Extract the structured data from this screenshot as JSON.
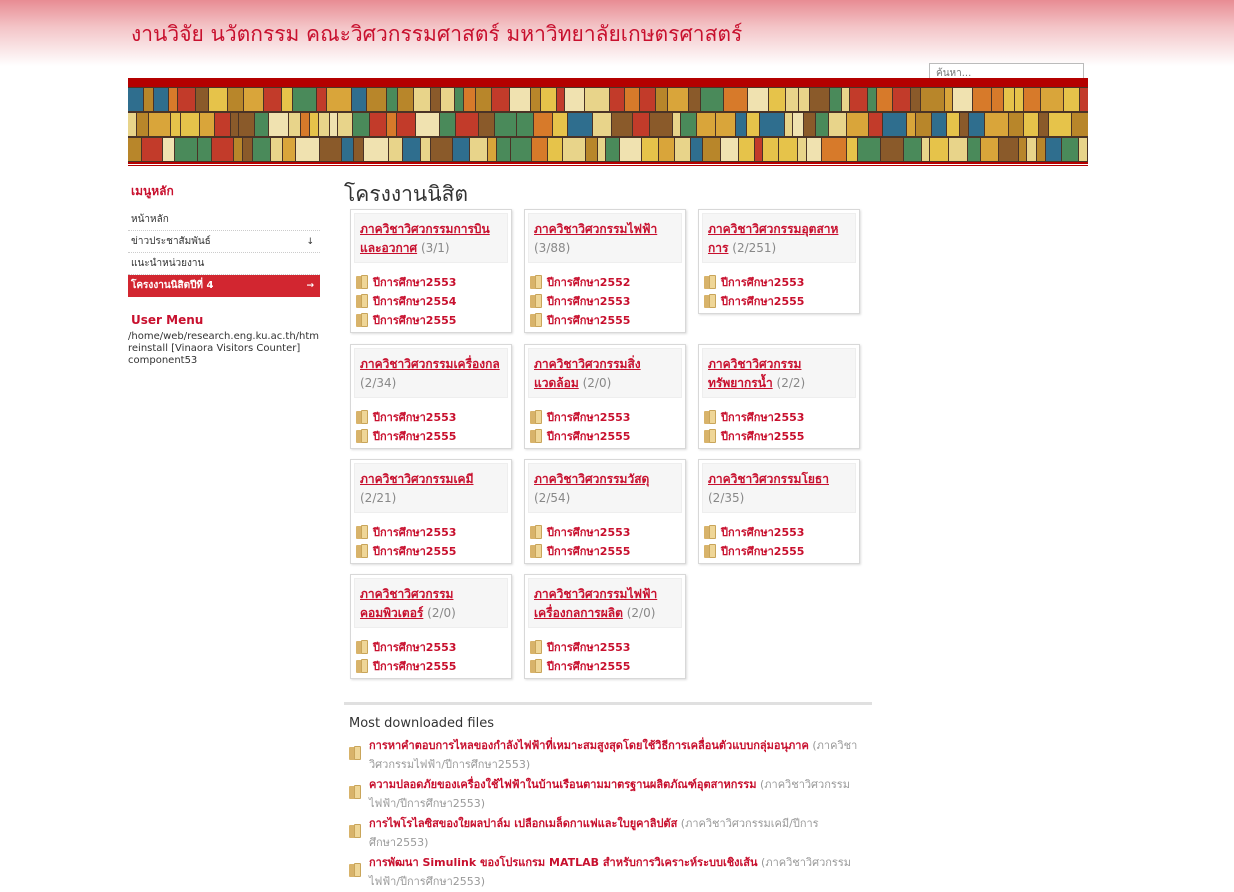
{
  "header": {
    "site_title": "งานวิจัย นวัตกรรม คณะวิศวกรรมศาสตร์ มหาวิทยาลัยเกษตรศาสตร์",
    "search_placeholder": "ค้นหา..."
  },
  "colors": {
    "brand": "#c8102e",
    "bar": "#b40000",
    "active": "#d22630"
  },
  "sidebar": {
    "menu_title": "เมนูหลัก",
    "items": [
      {
        "label": "หน้าหลัก",
        "arrow": ""
      },
      {
        "label": "ข่าวประชาสัมพันธ์",
        "arrow": "↓"
      },
      {
        "label": "แนะนำหน่วยงาน",
        "arrow": ""
      },
      {
        "label": "โครงงานนิสิตปีที่ 4",
        "arrow": "→"
      }
    ],
    "user_menu_title": "User Menu",
    "user_menu_lines": [
      "/home/web/research.eng.ku.ac.th/htm",
      "reinstall [Vinaora Visitors Counter]",
      "component53"
    ]
  },
  "main": {
    "page_title": "โครงงานนิสิต",
    "departments": [
      {
        "name": "ภาควิชาวิศวกรรมการบินและอวกาศ",
        "count": "(3/1)",
        "years": [
          "ปีการศึกษา2553",
          "ปีการศึกษา2554",
          "ปีการศึกษา2555"
        ]
      },
      {
        "name": "ภาควิชาวิศวกรรมไฟฟ้า",
        "count": "(3/88)",
        "years": [
          "ปีการศึกษา2552",
          "ปีการศึกษา2553",
          "ปีการศึกษา2555"
        ]
      },
      {
        "name": "ภาควิชาวิศวกรรมอุตสาหการ",
        "count": "(2/251)",
        "years": [
          "ปีการศึกษา2553",
          "ปีการศึกษา2555"
        ]
      },
      {
        "name": "ภาควิชาวิศวกรรมเครื่องกล",
        "count": "(2/34)",
        "years": [
          "ปีการศึกษา2553",
          "ปีการศึกษา2555"
        ]
      },
      {
        "name": "ภาควิชาวิศวกรรมสิ่งแวดล้อม",
        "count": "(2/0)",
        "years": [
          "ปีการศึกษา2553",
          "ปีการศึกษา2555"
        ]
      },
      {
        "name": "ภาควิชาวิศวกรรมทรัพยากรน้ำ",
        "count": "(2/2)",
        "years": [
          "ปีการศึกษา2553",
          "ปีการศึกษา2555"
        ]
      },
      {
        "name": "ภาควิชาวิศวกรรมเคมี",
        "count": "(2/21)",
        "years": [
          "ปีการศึกษา2553",
          "ปีการศึกษา2555"
        ]
      },
      {
        "name": "ภาควิชาวิศวกรรมวัสดุ",
        "count": "(2/54)",
        "years": [
          "ปีการศึกษา2553",
          "ปีการศึกษา2555"
        ]
      },
      {
        "name": "ภาควิชาวิศวกรรมโยธา",
        "count": "(2/35)",
        "years": [
          "ปีการศึกษา2553",
          "ปีการศึกษา2555"
        ]
      },
      {
        "name": "ภาควิชาวิศวกรรมคอมพิวเตอร์",
        "count": "(2/0)",
        "years": [
          "ปีการศึกษา2553",
          "ปีการศึกษา2555"
        ]
      },
      {
        "name": "ภาควิชาวิศวกรรมไฟฟ้าเครื่องกลการผลิต",
        "count": "(2/0)",
        "years": [
          "ปีการศึกษา2553",
          "ปีการศึกษา2555"
        ]
      }
    ]
  },
  "downloads": {
    "title": "Most downloaded files",
    "items": [
      {
        "title": "การหาคำตอบการไหลของกำลังไฟฟ้าที่เหมาะสมสูงสุดโดยใช้วิธีการเคลื่อนตัวแบบกลุ่มอนุภาค",
        "path": "(ภาควิชาวิศวกรรมไฟฟ้า/ปีการศึกษา2553)"
      },
      {
        "title": "ความปลอดภัยของเครื่องใช้ไฟฟ้าในบ้านเรือนตามมาตรฐานผลิตภัณฑ์อุตสาหกรรม",
        "path": "(ภาควิชาวิศวกรรมไฟฟ้า/ปีการศึกษา2553)"
      },
      {
        "title": "การไพโรไลซิสของใยผลปาล์ม เปลือกเมล็ดกาแฟและใบยูคาลิปตัส",
        "path": "(ภาควิชาวิศวกรรมเคมี/ปีการศึกษา2553)"
      },
      {
        "title": "การพัฒนา Simulink ของโปรแกรม MATLAB สำหรับการวิเคราะห์ระบบเชิงเส้น",
        "path": "(ภาควิชาวิศวกรรมไฟฟ้า/ปีการศึกษา2553)"
      }
    ]
  }
}
